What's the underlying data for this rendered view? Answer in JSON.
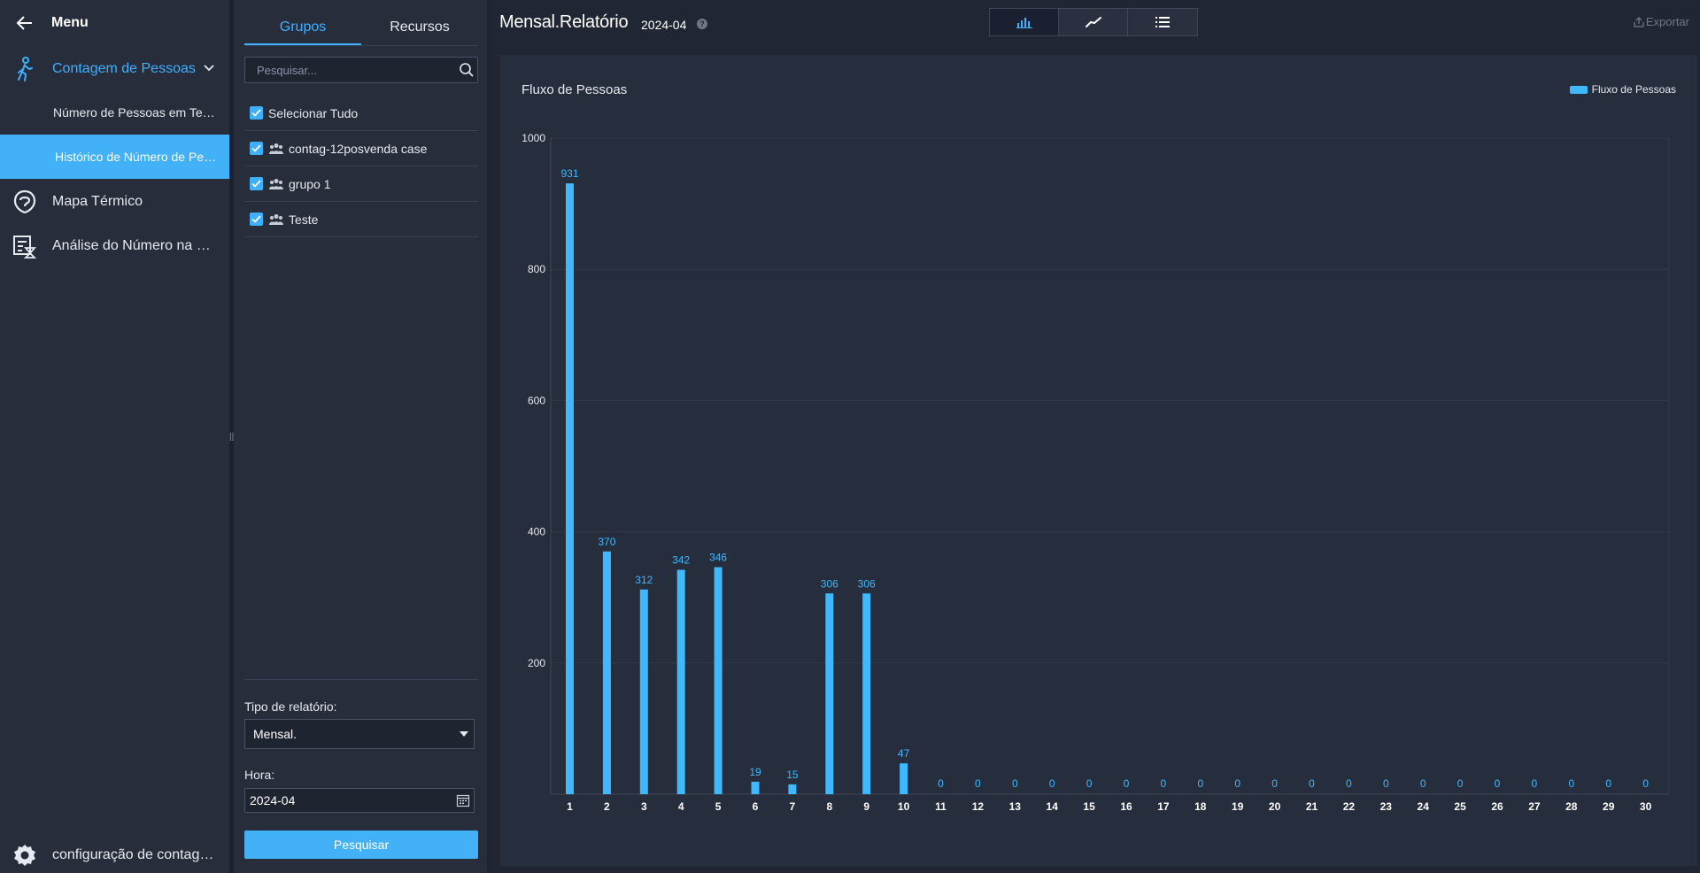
{
  "nav": {
    "title": "Menu",
    "group_label": "Contagem de Pessoas",
    "sub_items": [
      {
        "label": "Número de Pessoas em Tempo Real"
      },
      {
        "label": "Histórico de Número de Pessoas"
      }
    ],
    "items": [
      {
        "label": "Mapa Térmico"
      },
      {
        "label": "Análise do Número na Área"
      }
    ],
    "bottom_label": "configuração de contagem de pessoas"
  },
  "panel": {
    "tabs": [
      {
        "label": "Grupos"
      },
      {
        "label": "Recursos"
      }
    ],
    "search_placeholder": "Pesquisar...",
    "select_all": "Selecionar Tudo",
    "groups": [
      {
        "label": "contag-12posvenda case"
      },
      {
        "label": "grupo 1"
      },
      {
        "label": "Teste"
      }
    ],
    "report_type_label": "Tipo de relatório:",
    "report_type_value": "Mensal.",
    "time_label": "Hora:",
    "time_value": "2024-04",
    "search_button": "Pesquisar"
  },
  "main": {
    "title": "Mensal.Relatório",
    "period": "2024-04",
    "help": "?",
    "export_label": "Exportar"
  },
  "colors": {
    "accent": "#3fb0ff",
    "bar": "#3fb8ff",
    "active_nav": "#42b1f7"
  },
  "chart_data": {
    "type": "bar",
    "title": "Fluxo de Pessoas",
    "legend": "top-right",
    "grid": true,
    "xlabel": "",
    "ylabel": "",
    "ylim": [
      0,
      1000
    ],
    "yticks": [
      "200",
      "400",
      "600",
      "800",
      "1000"
    ],
    "categories": [
      "1",
      "2",
      "3",
      "4",
      "5",
      "6",
      "7",
      "8",
      "9",
      "10",
      "11",
      "12",
      "13",
      "14",
      "15",
      "16",
      "17",
      "18",
      "19",
      "20",
      "21",
      "22",
      "23",
      "24",
      "25",
      "26",
      "27",
      "28",
      "29",
      "30"
    ],
    "series": [
      {
        "name": "Fluxo de Pessoas",
        "values": [
          931,
          370,
          312,
          342,
          346,
          19,
          15,
          306,
          306,
          47,
          0,
          0,
          0,
          0,
          0,
          0,
          0,
          0,
          0,
          0,
          0,
          0,
          0,
          0,
          0,
          0,
          0,
          0,
          0,
          0
        ]
      }
    ]
  }
}
